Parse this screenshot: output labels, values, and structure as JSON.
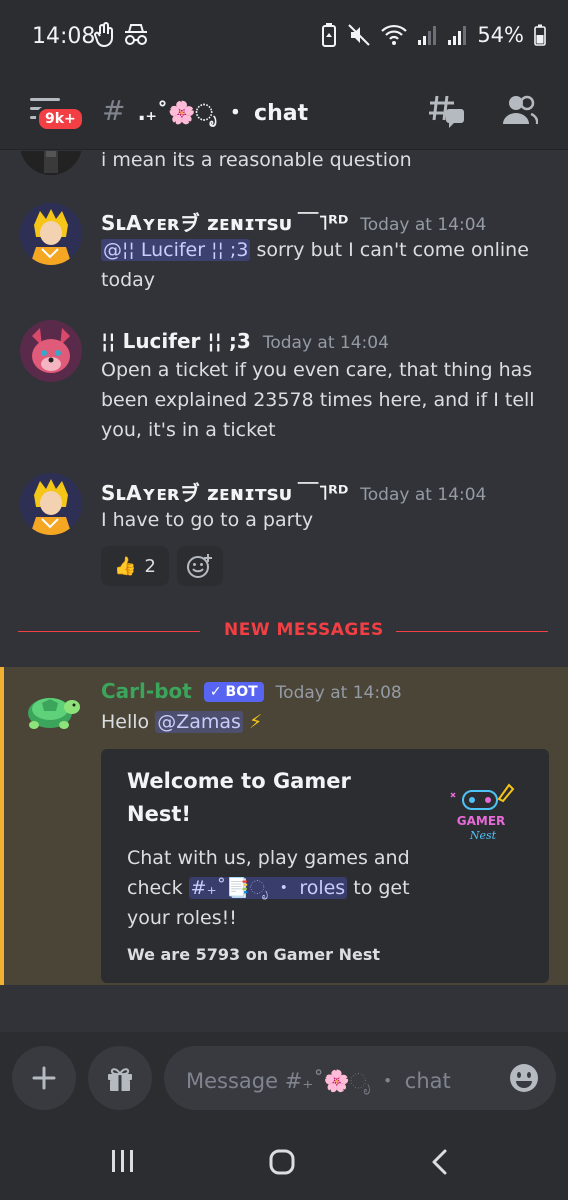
{
  "status_bar": {
    "time": "14:08",
    "battery": "54%"
  },
  "header": {
    "badge": "9k+",
    "hash": "#",
    "channel_name": "․₊˚🌸ೃ ・ chat"
  },
  "messages": [
    {
      "text": "i mean its a reasonable question"
    },
    {
      "author": "SʟAʏᴇʀヺ ᴢᴇɴɪᴛsᴜ ￣˥ᴿᴰ",
      "timestamp": "Today at 14:04",
      "mention": "@¦¦ Lucifer ¦¦ ;3",
      "text": " sorry but I can't come online today"
    },
    {
      "author": "¦¦ Lucifer ¦¦ ;3",
      "timestamp": "Today at 14:04",
      "text": "Open a ticket if you even care, that thing has been explained 23578 times here, and if I tell you, it's in a ticket"
    },
    {
      "author": "SʟAʏᴇʀヺ ᴢᴇɴɪᴛsᴜ ￣˥ᴿᴰ",
      "timestamp": "Today at 14:04",
      "text": "I have to go to a party",
      "reaction_emoji": "👍",
      "reaction_count": "2"
    }
  ],
  "divider": {
    "label": "NEW MESSAGES"
  },
  "bot_message": {
    "author": "Carl-bot",
    "bot_tag": "BOT",
    "check": "✓",
    "timestamp": "Today at 14:08",
    "greeting": "Hello ",
    "mention": "@Zamas",
    "emoji": "⚡",
    "embed": {
      "title": "Welcome to Gamer Nest!",
      "desc_before": "Chat with us, play games and check ",
      "channel_mention": "#₊˚📑ೃ ・ roles",
      "desc_after": " to get your roles!!",
      "footer": "We are 5793 on Gamer Nest",
      "thumb_text_1": "GAMER",
      "thumb_text_2": "Nest"
    }
  },
  "input": {
    "placeholder": "Message #₊˚🌸ೃ ・ chat"
  },
  "colors": {
    "background": "#313338",
    "surface": "#2b2d31",
    "accent": "#5865f2",
    "danger": "#f23f43",
    "highlight": "#f0b132",
    "carl_green": "#3ba55c"
  }
}
